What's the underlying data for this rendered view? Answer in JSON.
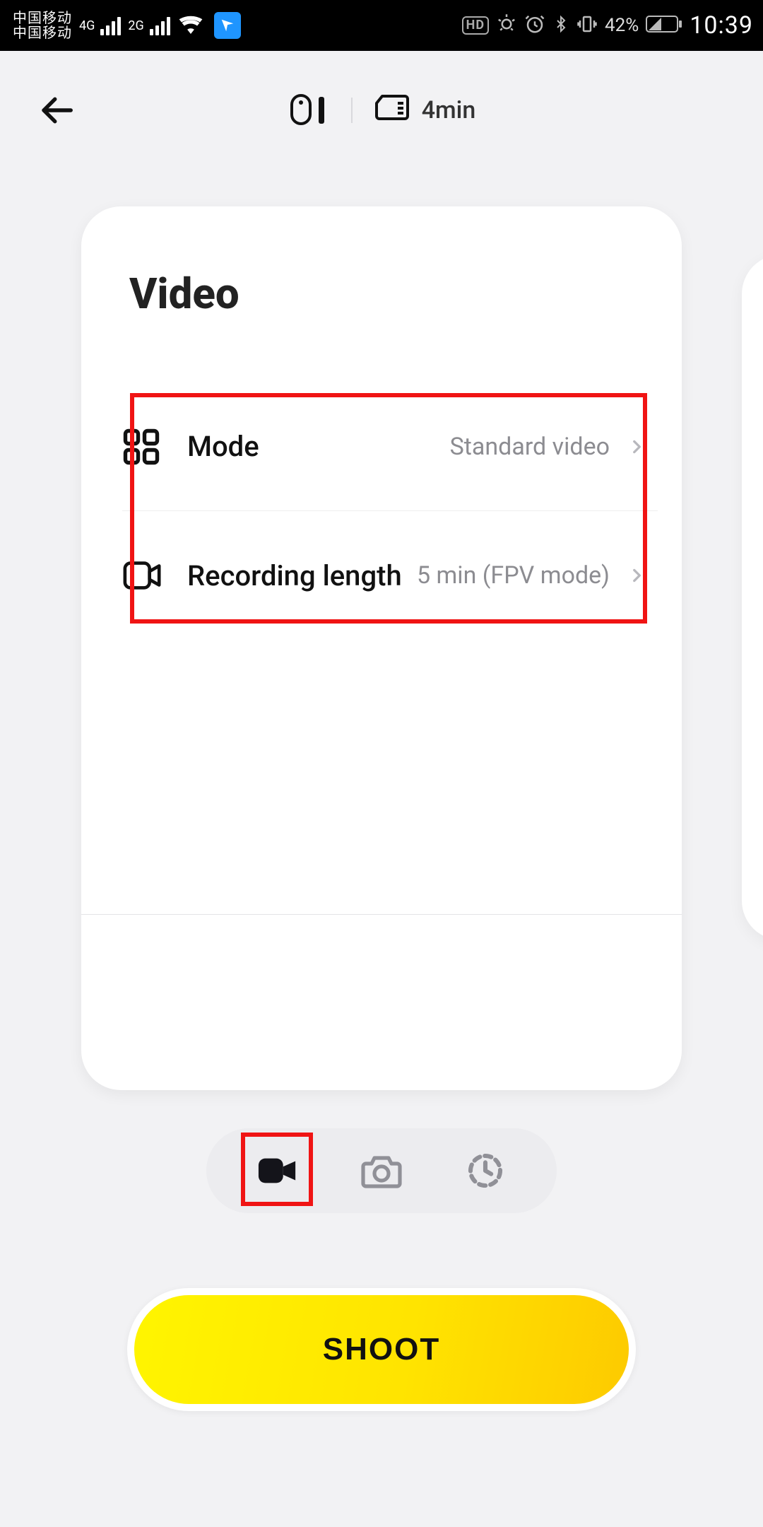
{
  "statusbar": {
    "carrier1": "中国移动",
    "carrier2": "中国移动",
    "net1": "4G",
    "net2": "2G",
    "hd": "HD",
    "battery": "42%",
    "time": "10:39"
  },
  "header": {
    "storage_time": "4min"
  },
  "card": {
    "title": "Video",
    "rows": [
      {
        "icon": "grid",
        "label": "Mode",
        "value": "Standard video"
      },
      {
        "icon": "video",
        "label": "Recording length",
        "value": "5 min (FPV mode)"
      }
    ]
  },
  "shoot": {
    "label": "SHOOT"
  }
}
